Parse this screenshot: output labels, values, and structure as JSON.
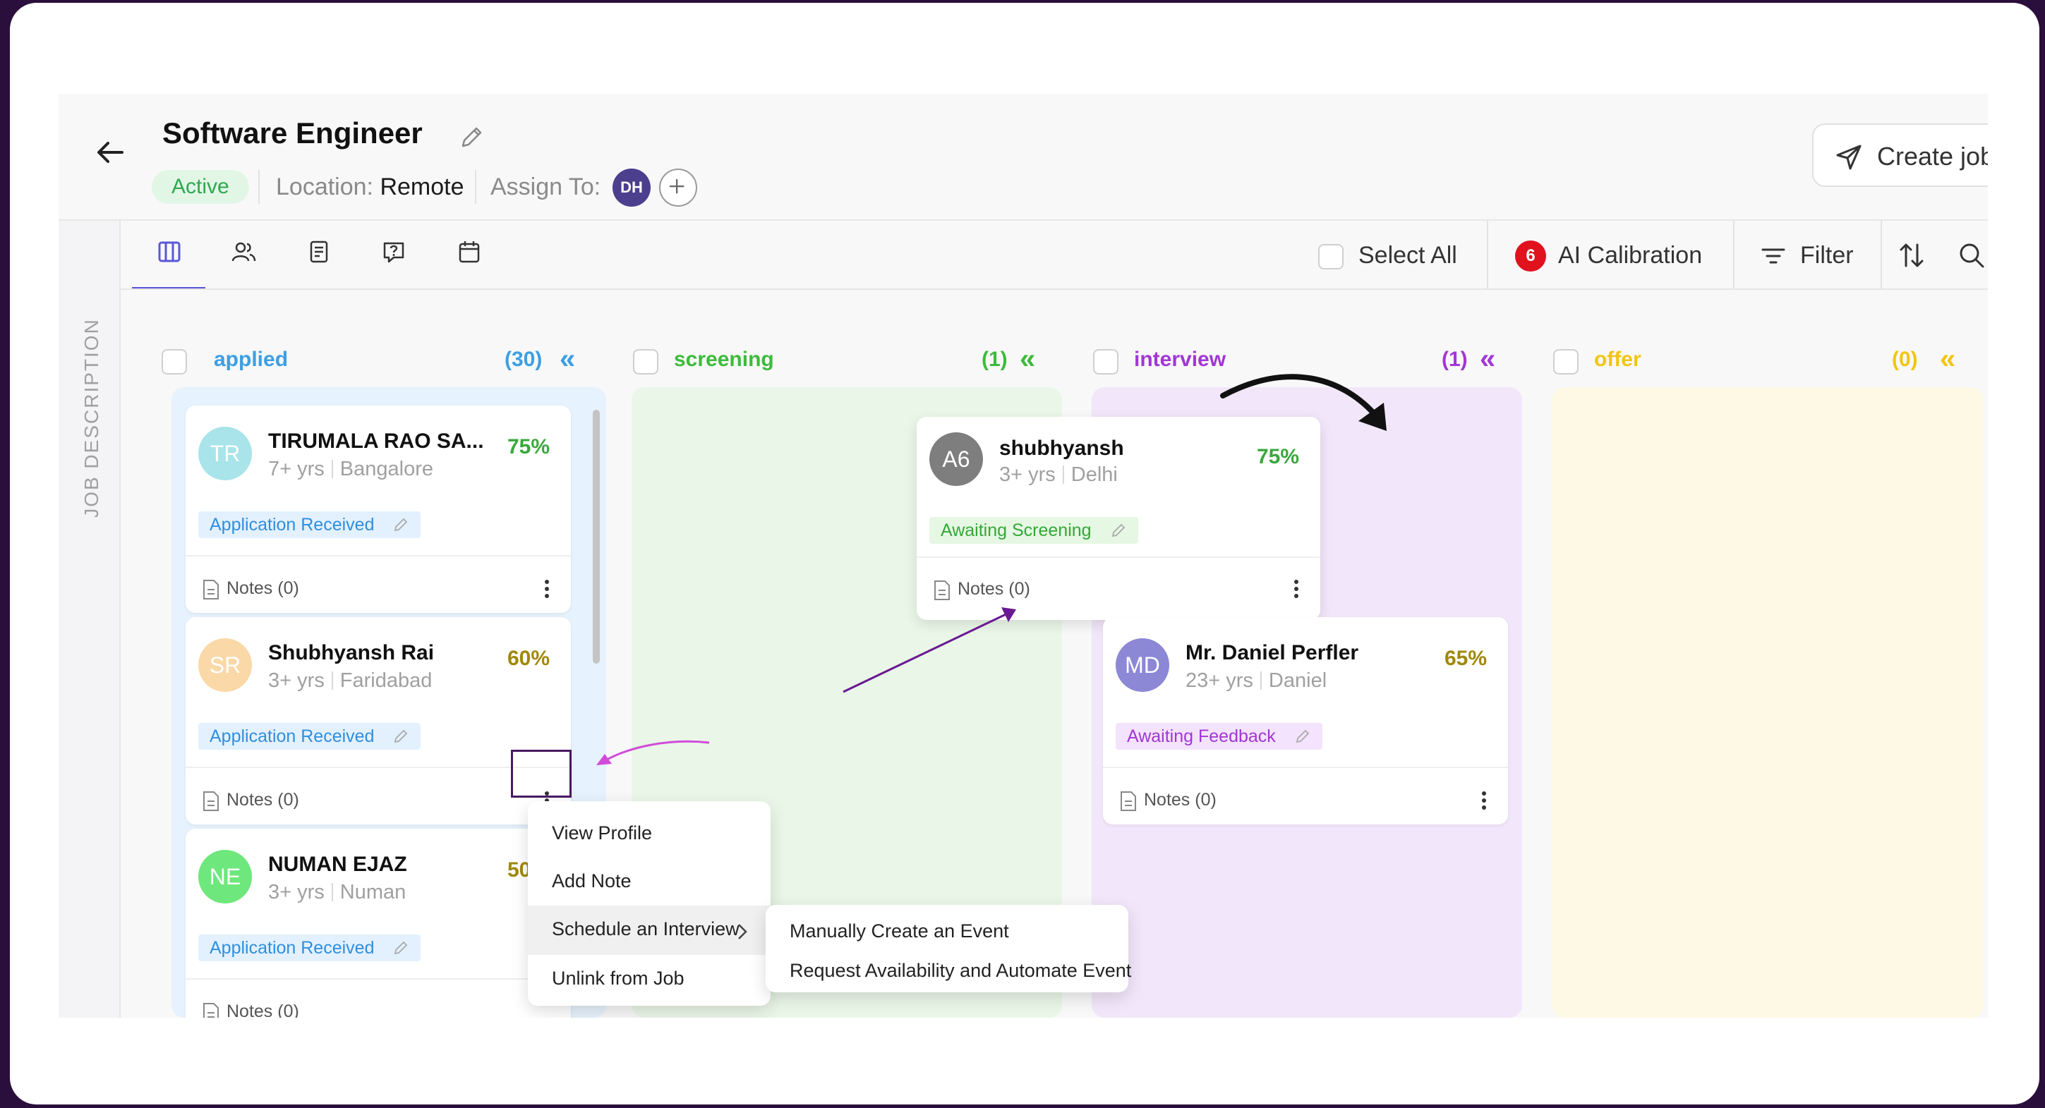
{
  "header": {
    "title": "Software Engineer",
    "status": "Active",
    "location_label": "Location:",
    "location_value": "Remote",
    "assign_label": "Assign To:",
    "assignee_initials": "DH",
    "create_job": "Create job"
  },
  "sidebar": {
    "label": "JOB DESCRIPTION"
  },
  "toolbar": {
    "select_all": "Select All",
    "ai_calibration_count": "6",
    "ai_calibration": "AI Calibration",
    "filter": "Filter"
  },
  "columns": [
    {
      "title": "applied",
      "count": "(30)",
      "collapse": "«",
      "color": "#3d9fe3"
    },
    {
      "title": "screening",
      "count": "(1)",
      "collapse": "«",
      "color": "#3dbb3a"
    },
    {
      "title": "interview",
      "count": "(1)",
      "collapse": "«",
      "color": "#a236d6"
    },
    {
      "title": "offer",
      "count": "(0)",
      "collapse": "«",
      "color": "#f2c511"
    }
  ],
  "cards": {
    "tr": {
      "initials": "TR",
      "name": "TIRUMALA RAO SA...",
      "exp": "7+ yrs",
      "city": "Bangalore",
      "score": "75%",
      "status": "Application Received",
      "notes": "Notes (0)"
    },
    "sr": {
      "initials": "SR",
      "name": "Shubhyansh Rai",
      "exp": "3+ yrs",
      "city": "Faridabad",
      "score": "60%",
      "status": "Application Received",
      "notes": "Notes (0)"
    },
    "ne": {
      "initials": "NE",
      "name": "NUMAN EJAZ",
      "exp": "3+ yrs",
      "city": "Numan",
      "score": "50%",
      "status": "Application Received",
      "notes": "Notes (0)"
    },
    "a6": {
      "initials": "A6",
      "name": "shubhyansh",
      "exp": "3+ yrs",
      "city": "Delhi",
      "score": "75%",
      "status": "Awaiting Screening",
      "notes": "Notes (0)"
    },
    "md": {
      "initials": "MD",
      "name": "Mr. Daniel Perfler",
      "exp": "23+ yrs",
      "city": "Daniel",
      "score": "65%",
      "status": "Awaiting Feedback",
      "notes": "Notes (0)"
    }
  },
  "context_menu": {
    "items": [
      "View Profile",
      "Add Note",
      "Schedule an Interview",
      "Unlink from Job"
    ],
    "submenu": [
      "Manually Create an Event",
      "Request Availability and Automate Event"
    ]
  }
}
